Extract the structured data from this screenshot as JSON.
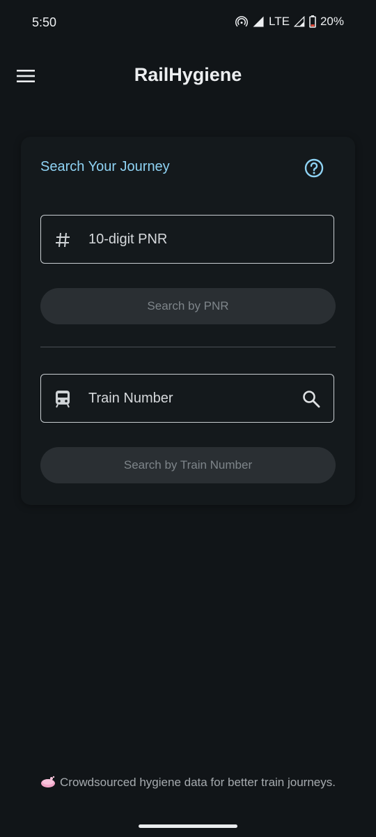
{
  "status_bar": {
    "time": "5:50",
    "network": "LTE",
    "battery": "20%"
  },
  "app_bar": {
    "title": "RailHygiene"
  },
  "search_card": {
    "title": "Search Your Journey",
    "pnr_placeholder": "10-digit PNR",
    "pnr_button": "Search by PNR",
    "train_placeholder": "Train Number",
    "train_button": "Search by Train Number"
  },
  "footer": {
    "text": "Crowdsourced hygiene data for better train journeys."
  },
  "colors": {
    "background": "#111518",
    "accent": "#8fd3f4",
    "button_disabled_bg": "#2a2f33",
    "button_disabled_text": "#7e858a"
  },
  "icons": {
    "menu": "menu-icon",
    "help": "help-circle-icon",
    "pnr": "hash-icon",
    "train": "train-icon",
    "search": "search-icon",
    "footer": "soap-icon"
  }
}
